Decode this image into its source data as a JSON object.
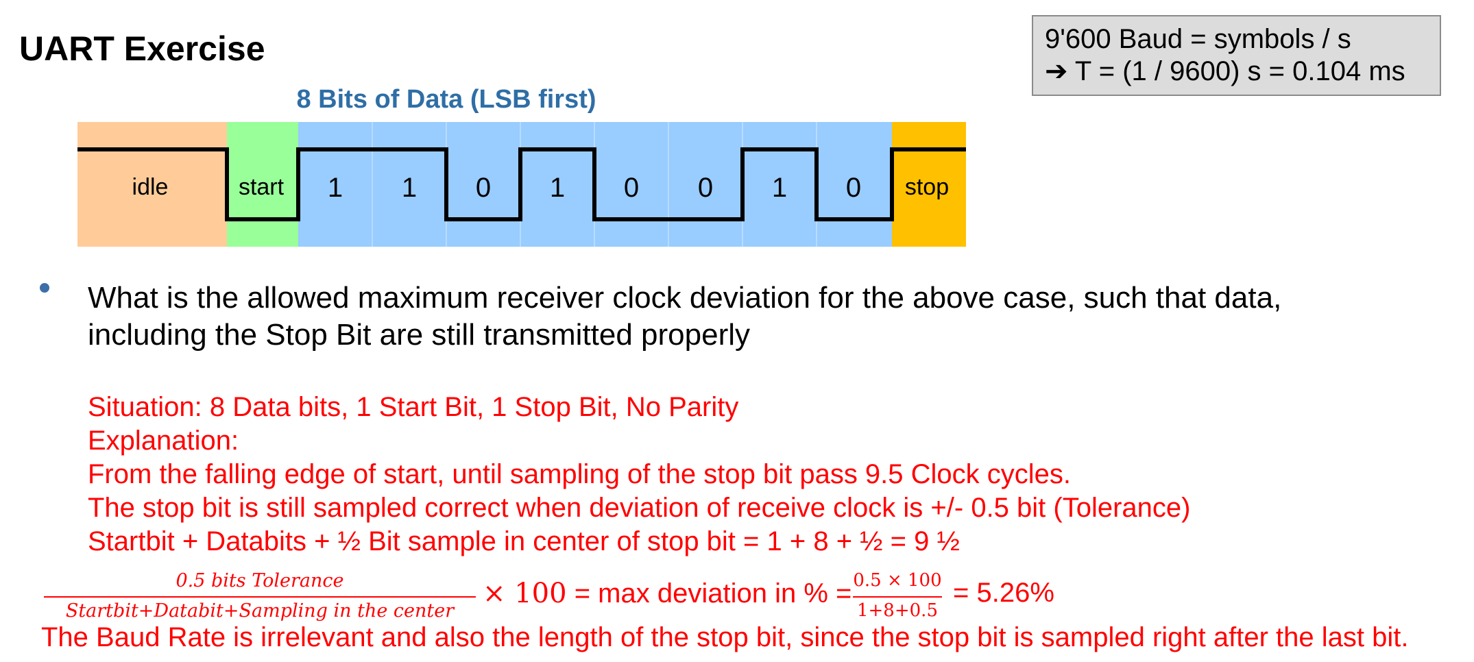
{
  "title": "UART Exercise",
  "baud_box": {
    "line1": "9'600 Baud = symbols / s",
    "line2": "➔ T = (1 / 9600) s = 0.104 ms"
  },
  "diagram": {
    "data_header": "8 Bits of Data (LSB first)",
    "idle_label": "idle",
    "start_label": "start",
    "stop_label": "stop",
    "bits": [
      "1",
      "1",
      "0",
      "1",
      "0",
      "0",
      "1",
      "0"
    ],
    "colors": {
      "idle": "#ffcc99",
      "start": "#99ff99",
      "data": "#99ccff",
      "stop": "#ffc000",
      "header": "#2f6ea6"
    }
  },
  "question": {
    "line1": "What is the allowed maximum receiver clock deviation for the above case, such that data,",
    "line2": "including the Stop Bit are still transmitted properly"
  },
  "answer": {
    "situation": "Situation: 8 Data bits, 1 Start Bit, 1 Stop Bit, No Parity",
    "explanation": "Explanation:",
    "line1": "From the falling edge of start, until sampling of the stop bit pass 9.5 Clock cycles.",
    "line2": "The stop bit is still sampled correct when deviation of receive clock is +/- 0.5 bit (Tolerance)",
    "line3": "Startbit + Databits + ½ Bit sample in center of stop bit = 1 + 8 + ½ = 9 ½"
  },
  "formula": {
    "frac1_num": "0.5 bits Tolerance",
    "frac1_den": "Startbit+Databit+Sampling in the center",
    "times": "× 100",
    "middle": " = max deviation in % =",
    "frac2_num": "0.5 × 100",
    "frac2_den": "1+8+0.5",
    "result": "= 5.26%"
  },
  "conclusion": "The Baud Rate is irrelevant and also the length of the stop bit, since the stop bit is sampled right after the last bit."
}
